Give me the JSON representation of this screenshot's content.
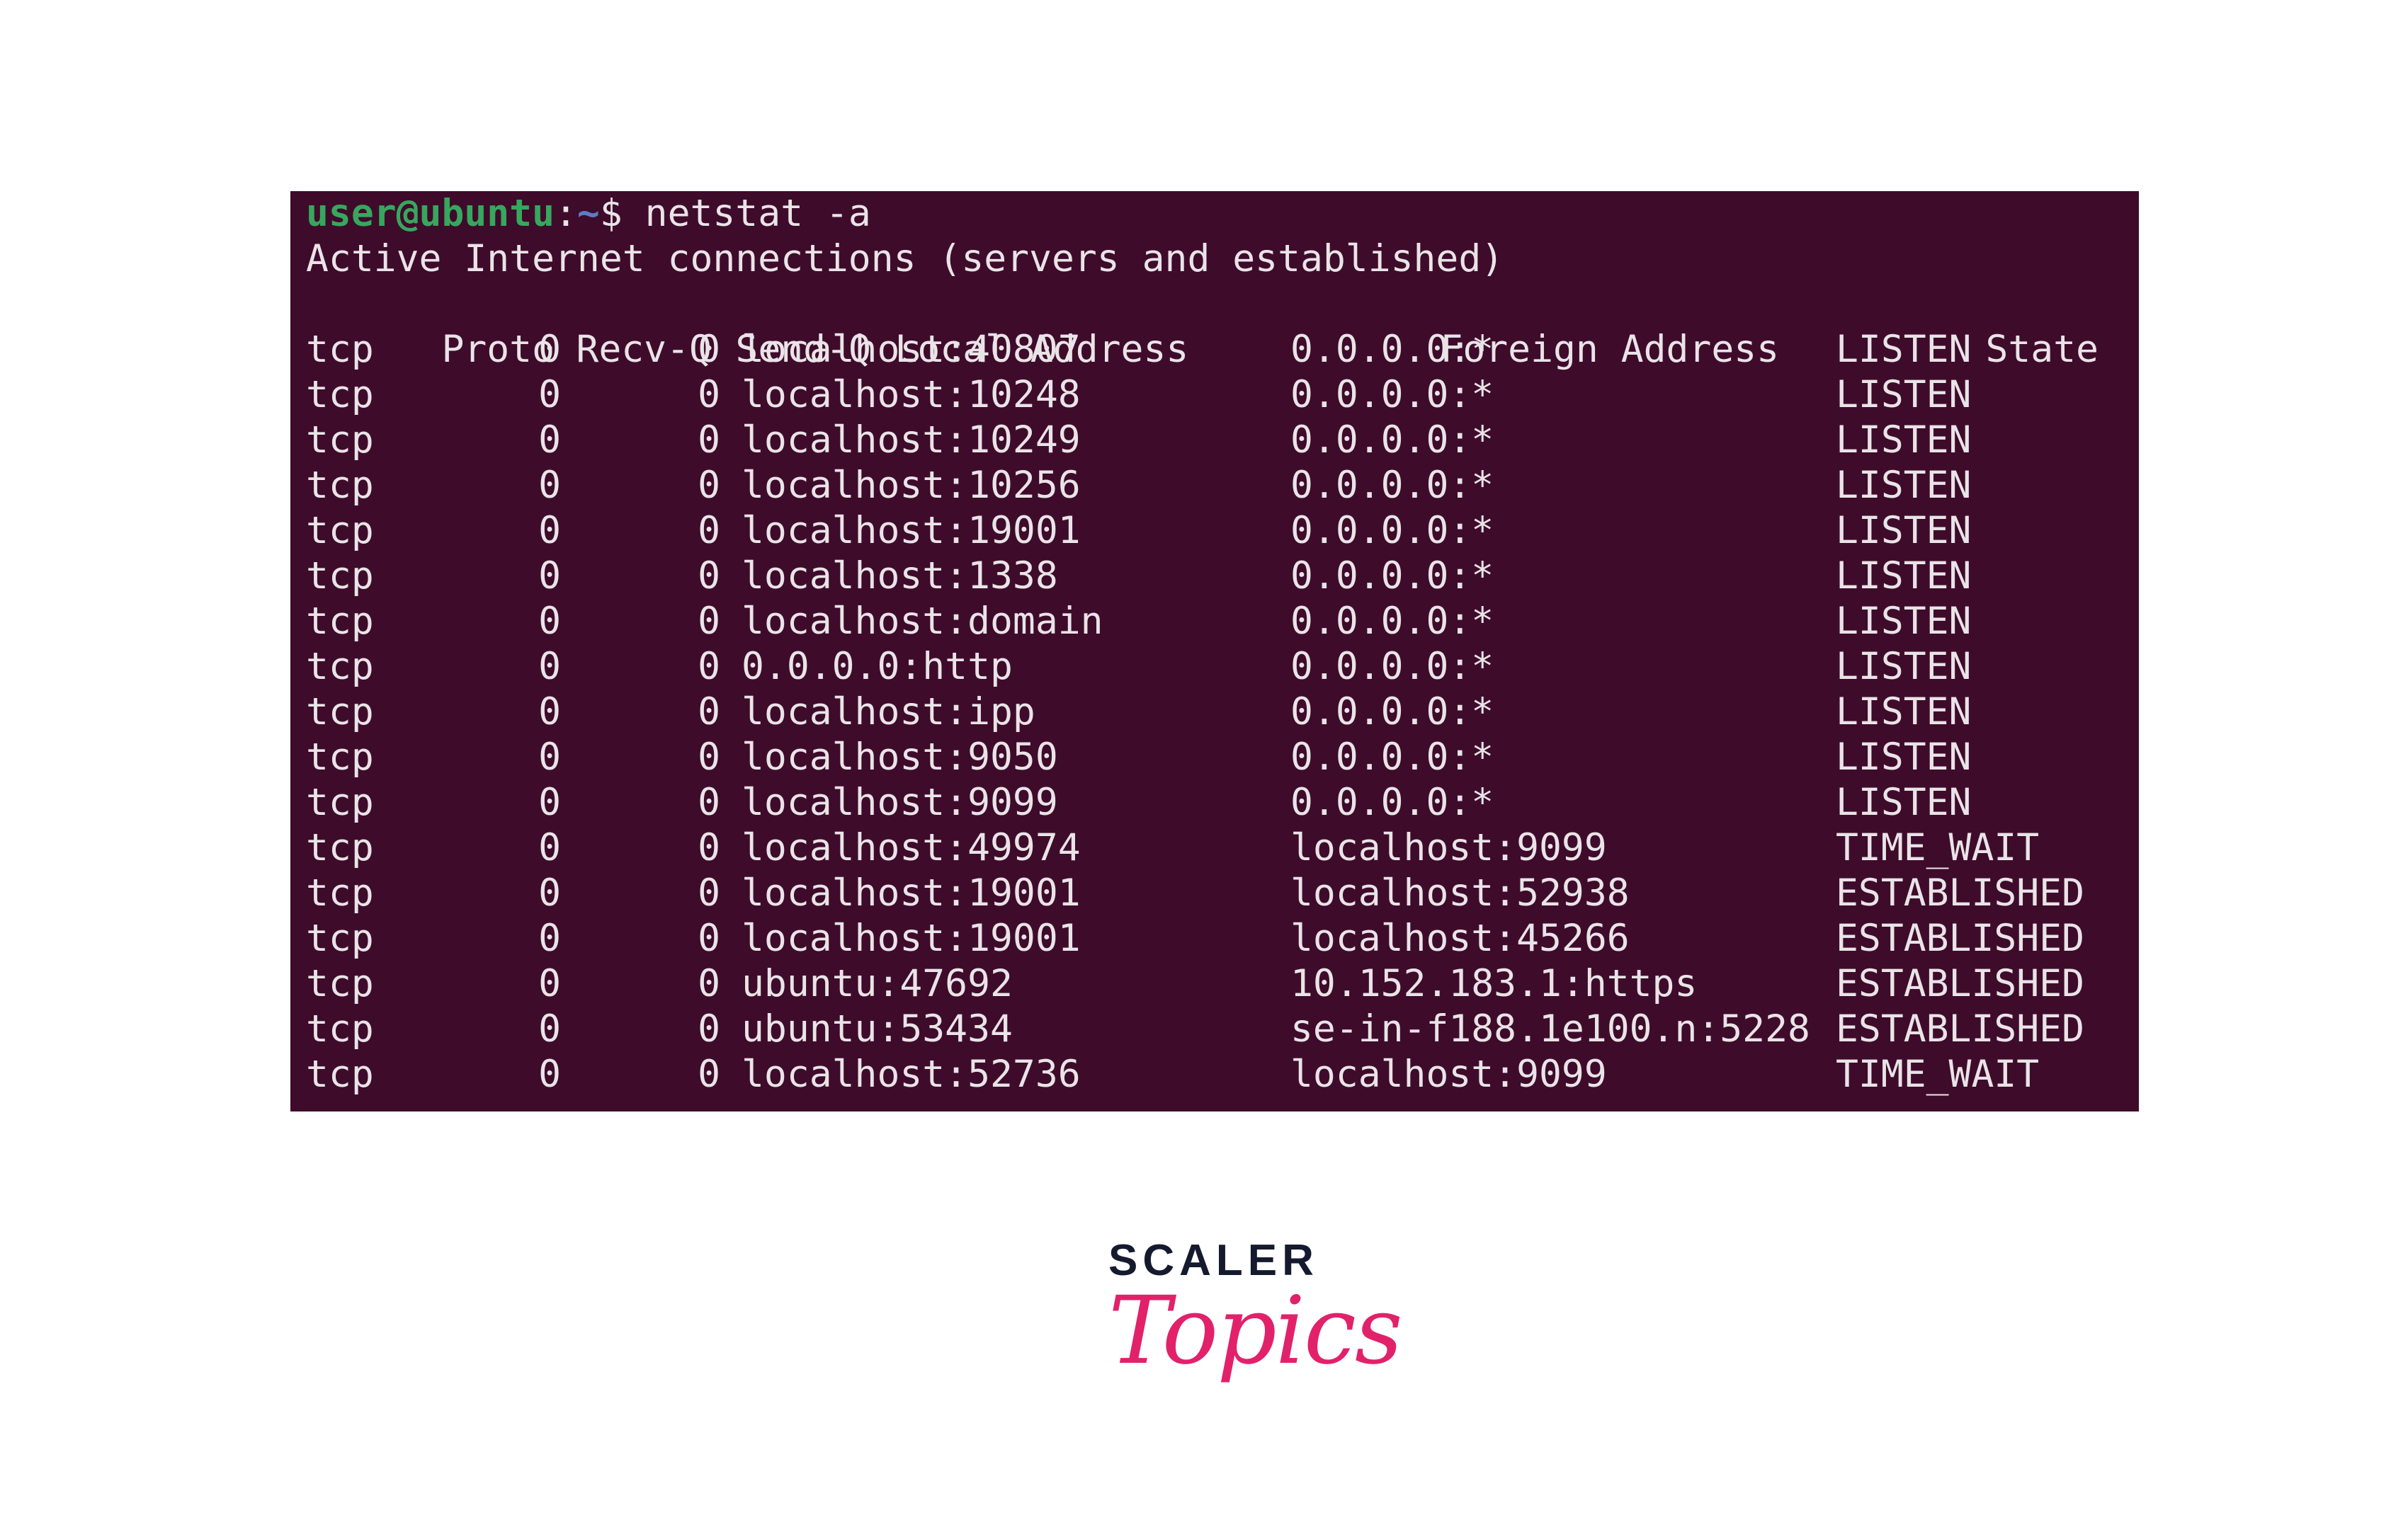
{
  "terminal": {
    "prompt_user": "user@ubuntu",
    "prompt_sep": ":",
    "prompt_path": "~",
    "prompt_symbol": "$ ",
    "command": "netstat -a",
    "heading": "Active Internet connections (servers and established)",
    "columns": [
      "Proto",
      "Recv-Q",
      "Send-Q",
      "Local Address",
      "Foreign Address",
      "State"
    ],
    "rows": [
      [
        "tcp",
        "0",
        "0",
        "localhost:40807",
        "0.0.0.0:*",
        "LISTEN"
      ],
      [
        "tcp",
        "0",
        "0",
        "localhost:10248",
        "0.0.0.0:*",
        "LISTEN"
      ],
      [
        "tcp",
        "0",
        "0",
        "localhost:10249",
        "0.0.0.0:*",
        "LISTEN"
      ],
      [
        "tcp",
        "0",
        "0",
        "localhost:10256",
        "0.0.0.0:*",
        "LISTEN"
      ],
      [
        "tcp",
        "0",
        "0",
        "localhost:19001",
        "0.0.0.0:*",
        "LISTEN"
      ],
      [
        "tcp",
        "0",
        "0",
        "localhost:1338",
        "0.0.0.0:*",
        "LISTEN"
      ],
      [
        "tcp",
        "0",
        "0",
        "localhost:domain",
        "0.0.0.0:*",
        "LISTEN"
      ],
      [
        "tcp",
        "0",
        "0",
        "0.0.0.0:http",
        "0.0.0.0:*",
        "LISTEN"
      ],
      [
        "tcp",
        "0",
        "0",
        "localhost:ipp",
        "0.0.0.0:*",
        "LISTEN"
      ],
      [
        "tcp",
        "0",
        "0",
        "localhost:9050",
        "0.0.0.0:*",
        "LISTEN"
      ],
      [
        "tcp",
        "0",
        "0",
        "localhost:9099",
        "0.0.0.0:*",
        "LISTEN"
      ],
      [
        "tcp",
        "0",
        "0",
        "localhost:49974",
        "localhost:9099",
        "TIME_WAIT"
      ],
      [
        "tcp",
        "0",
        "0",
        "localhost:19001",
        "localhost:52938",
        "ESTABLISHED"
      ],
      [
        "tcp",
        "0",
        "0",
        "localhost:19001",
        "localhost:45266",
        "ESTABLISHED"
      ],
      [
        "tcp",
        "0",
        "0",
        "ubuntu:47692",
        "10.152.183.1:https",
        "ESTABLISHED"
      ],
      [
        "tcp",
        "0",
        "0",
        "ubuntu:53434",
        "se-in-f188.1e100.n:5228",
        "ESTABLISHED"
      ],
      [
        "tcp",
        "0",
        "0",
        "localhost:52736",
        "localhost:9099",
        "TIME_WAIT"
      ]
    ],
    "colors": {
      "background": "#3f0b2b",
      "text": "#e9e4e7",
      "prompt_user": "#37a75e",
      "prompt_path": "#5a7dc4"
    }
  },
  "logo": {
    "line1": "SCALER",
    "line2": "Topics",
    "colors": {
      "line1": "#151a2e",
      "line2": "#e2216b"
    }
  }
}
